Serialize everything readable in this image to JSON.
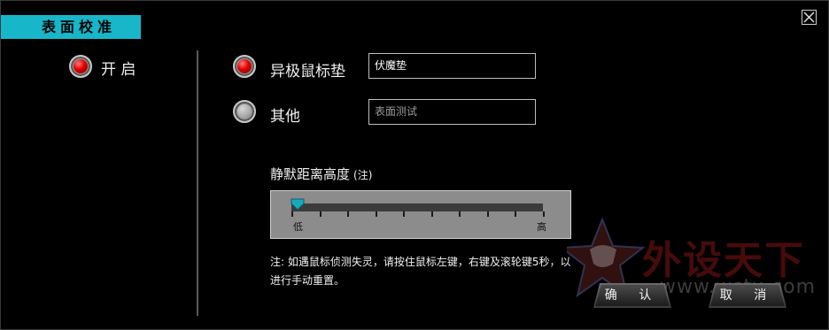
{
  "window": {
    "title": "表面校准",
    "close_icon": "close-icon"
  },
  "left": {
    "enable_label": "开 启",
    "enable_checked": true
  },
  "surface": {
    "option1_label": "异极鼠标垫",
    "option1_checked": true,
    "option1_value": "伏魔垫",
    "option2_label": "其他",
    "option2_checked": false,
    "option2_placeholder": "表面测试"
  },
  "silence": {
    "title": "静默距离高度",
    "note": "(注)",
    "low_label": "低",
    "high_label": "高",
    "level": 0,
    "tick_count": 10
  },
  "note_text": "注: 如遇鼠标侦测失灵，请按住鼠标左键，右键及滚轮键5秒，以进行手动重置。",
  "buttons": {
    "ok": "确 认",
    "cancel": "取 消"
  },
  "watermark": {
    "text": "外设天下",
    "url": "www.wstx.com"
  },
  "colors": {
    "accent": "#18b6c9",
    "radio_on": "#e00000",
    "background": "#000000"
  }
}
